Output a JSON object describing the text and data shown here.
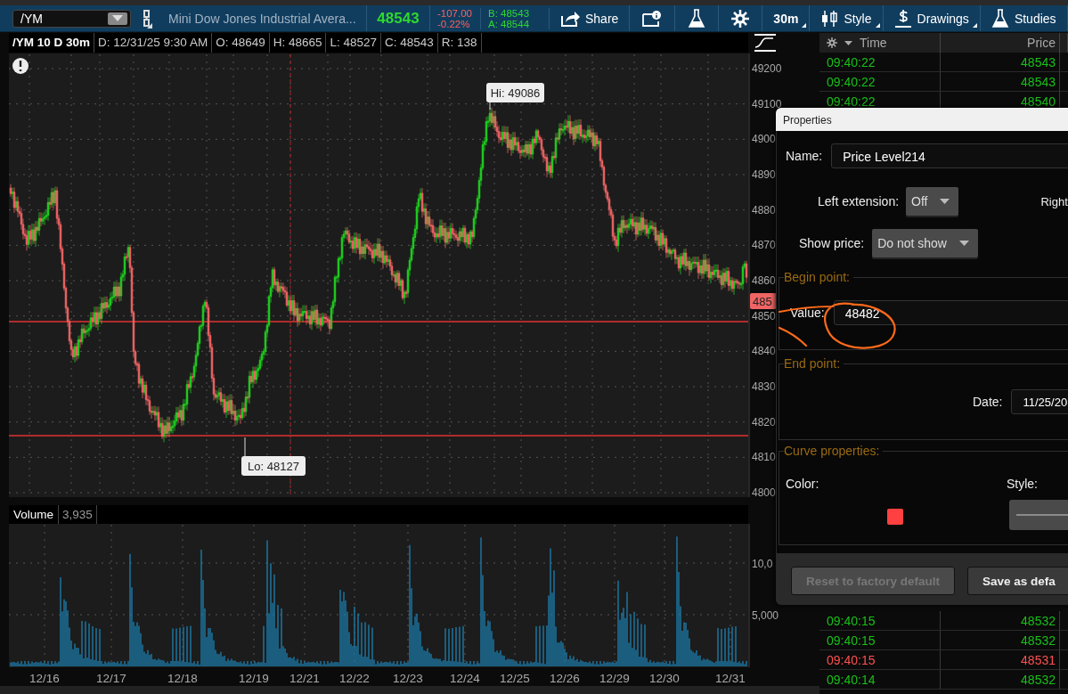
{
  "toolbar": {
    "symbol": "/YM",
    "description": "Mini Dow Jones Industrial Avera...",
    "last": "48543",
    "change": "-107.00",
    "change_pct": "-0.22%",
    "bid": "B: 48543",
    "ask": "A: 48544",
    "buttons": [
      {
        "label": "Share"
      },
      {
        "label": "30m"
      },
      {
        "label": "Style"
      },
      {
        "label": "Drawings"
      },
      {
        "label": "Studies"
      }
    ]
  },
  "chart_header": {
    "title": "/YM 10 D 30m",
    "fields": [
      "D: 12/31/25 9:30 AM",
      "O: 48649",
      "H: 48665",
      "L: 48527",
      "C: 48543",
      "R: 138"
    ]
  },
  "price_axis": [
    "49200",
    "49100",
    "4900",
    "4890",
    "4880",
    "4870",
    "4860",
    "4850",
    "4840",
    "4830",
    "4820",
    "4810",
    "4800"
  ],
  "price_tag": "485",
  "high_label": "Hi: 49086",
  "low_label": "Lo: 48127",
  "volume": {
    "title": "Volume",
    "value": "3,935",
    "axis": [
      "10,0",
      "5,000"
    ]
  },
  "dates": [
    "12/16",
    "12/17",
    "12/18",
    "12/19",
    "12/21",
    "12/22",
    "12/23",
    "12/24",
    "12/25",
    "12/26",
    "12/29",
    "12/30",
    "12/31"
  ],
  "time_sales": {
    "columns": [
      "Time",
      "Price"
    ],
    "rows_top": [
      {
        "time": "09:40:22",
        "price": "48543",
        "uptick": true
      },
      {
        "time": "09:40:22",
        "price": "48543",
        "uptick": true
      },
      {
        "time": "09:40:22",
        "price": "48540",
        "uptick": true
      }
    ],
    "rows_bottom": [
      {
        "time": "09:40:15",
        "price": "48532",
        "uptick": true
      },
      {
        "time": "09:40:15",
        "price": "48532",
        "uptick": true
      },
      {
        "time": "09:40:15",
        "price": "48531",
        "uptick": false
      },
      {
        "time": "09:40:14",
        "price": "48532",
        "uptick": true
      }
    ]
  },
  "properties": {
    "title": "Properties",
    "name_label": "Name:",
    "name": "Price Level214",
    "left_extension_label": "Left extension:",
    "left_extension": "Off",
    "right_label": "Right",
    "show_price_label": "Show price:",
    "show_price": "Do not show",
    "begin_point": {
      "legend": "Begin point:",
      "value_label": "Value:",
      "value": "48482"
    },
    "end_point": {
      "legend": "End point:",
      "date_label": "Date:",
      "date": "11/25/20"
    },
    "curve": {
      "legend": "Curve properties:",
      "color_label": "Color:",
      "color": "#ff4040",
      "style_label": "Style:"
    },
    "buttons": [
      {
        "label": "Reset to factory default",
        "disabled": true
      },
      {
        "label": "Save as defa",
        "disabled": false
      }
    ]
  }
}
